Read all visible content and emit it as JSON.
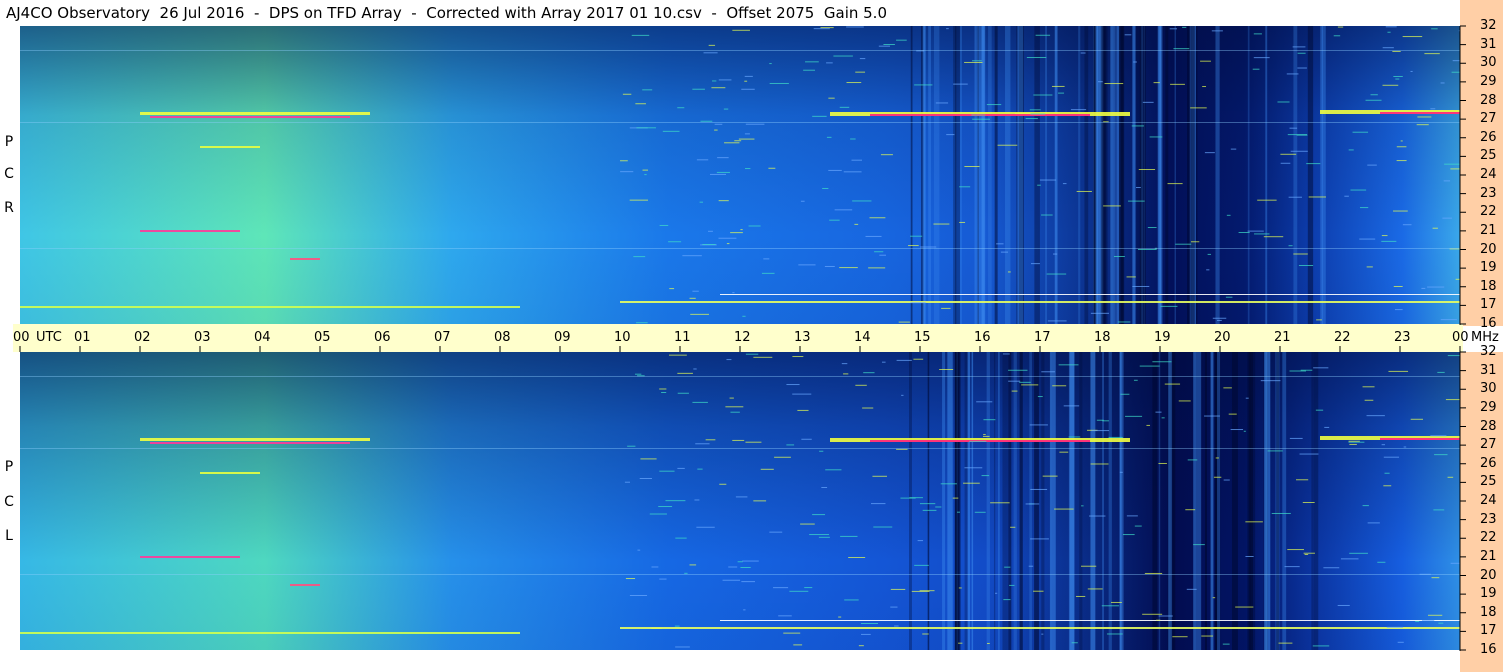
{
  "title": "AJ4CO Observatory  26 Jul 2016  -  DPS on TFD Array  -  Corrected with Array 2017 01 10.csv  -  Offset 2075  Gain 5.0",
  "colors": {
    "time_band": "#ffffcc",
    "freq_band": "#ffcfa6",
    "low": "#00004a",
    "mid": "#1a6ae6",
    "high": "#40e0c8",
    "peak": "#ff2080"
  },
  "chart_data": [
    {
      "type": "heatmap",
      "panel": "top",
      "polarization_label": [
        "R",
        "C",
        "P"
      ],
      "x_ticks": [
        "00",
        "01",
        "02",
        "03",
        "04",
        "05",
        "06",
        "07",
        "08",
        "09",
        "10",
        "11",
        "12",
        "13",
        "14",
        "15",
        "16",
        "17",
        "18",
        "19",
        "20",
        "21",
        "22",
        "23",
        "00"
      ],
      "x_unit": "UTC",
      "y_ticks": [
        "32",
        "31",
        "30",
        "29",
        "28",
        "27",
        "26",
        "25",
        "24",
        "23",
        "22",
        "21",
        "20",
        "19",
        "18",
        "17",
        "16"
      ],
      "y_unit": "MHz",
      "xlim": [
        0,
        24
      ],
      "ylim": [
        16,
        32
      ]
    },
    {
      "type": "heatmap",
      "panel": "bottom",
      "polarization_label": [
        "L",
        "C",
        "P"
      ],
      "x_ticks": [
        "00",
        "01",
        "02",
        "03",
        "04",
        "05",
        "06",
        "07",
        "08",
        "09",
        "10",
        "11",
        "12",
        "13",
        "14",
        "15",
        "16",
        "17",
        "18",
        "19",
        "20",
        "21",
        "22",
        "23",
        "00"
      ],
      "x_unit": "UTC",
      "y_ticks": [
        "32",
        "31",
        "30",
        "29",
        "28",
        "27",
        "26",
        "25",
        "24",
        "23",
        "22",
        "21",
        "20",
        "19",
        "18",
        "17",
        "16"
      ],
      "y_unit": "MHz",
      "xlim": [
        0,
        24
      ],
      "ylim": [
        16,
        32
      ]
    }
  ]
}
